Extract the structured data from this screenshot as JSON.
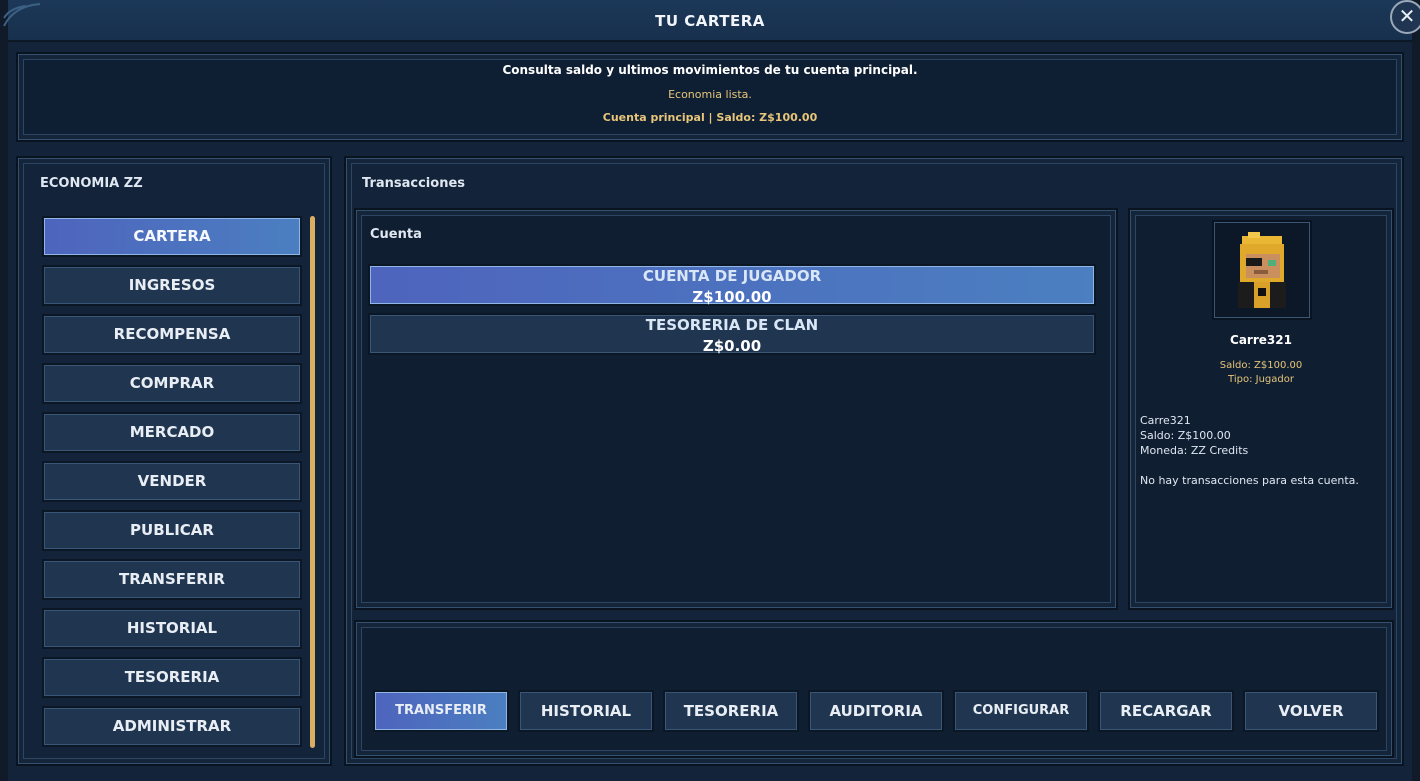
{
  "window": {
    "title": "TU CARTERA",
    "close_symbol": "✕"
  },
  "info": {
    "line1": "Consulta saldo y ultimos movimientos de tu cuenta principal.",
    "line2": "Economia lista.",
    "line3": "Cuenta principal | Saldo: Z$100.00"
  },
  "sidebar": {
    "title": "ECONOMIA ZZ",
    "active": "CARTERA",
    "items": [
      "CARTERA",
      "INGRESOS",
      "RECOMPENSA",
      "COMPRAR",
      "MERCADO",
      "VENDER",
      "PUBLICAR",
      "TRANSFERIR",
      "HISTORIAL",
      "TESORERIA",
      "ADMINISTRAR"
    ]
  },
  "content": {
    "title": "Transacciones",
    "accounts_title": "Cuenta",
    "accounts": [
      {
        "name": "CUENTA DE JUGADOR",
        "value": "Z$100.00"
      },
      {
        "name": "TESORERIA DE CLAN",
        "value": "Z$0.00"
      }
    ]
  },
  "profile": {
    "name": "Carre321",
    "saldo": "Saldo: Z$100.00",
    "tipo": "Tipo: Jugador",
    "details": [
      "Carre321",
      "Saldo: Z$100.00",
      "Moneda: ZZ Credits"
    ],
    "empty": "No hay transacciones para esta cuenta."
  },
  "actions": [
    "TRANSFERIR",
    "HISTORIAL",
    "TESORERIA",
    "AUDITORIA",
    "CONFIGURAR",
    "RECARGAR",
    "VOLVER"
  ],
  "colors": {
    "accent_gold": "#e7c57a",
    "active_blue": "#4e64bd",
    "panel": "#14253a"
  }
}
